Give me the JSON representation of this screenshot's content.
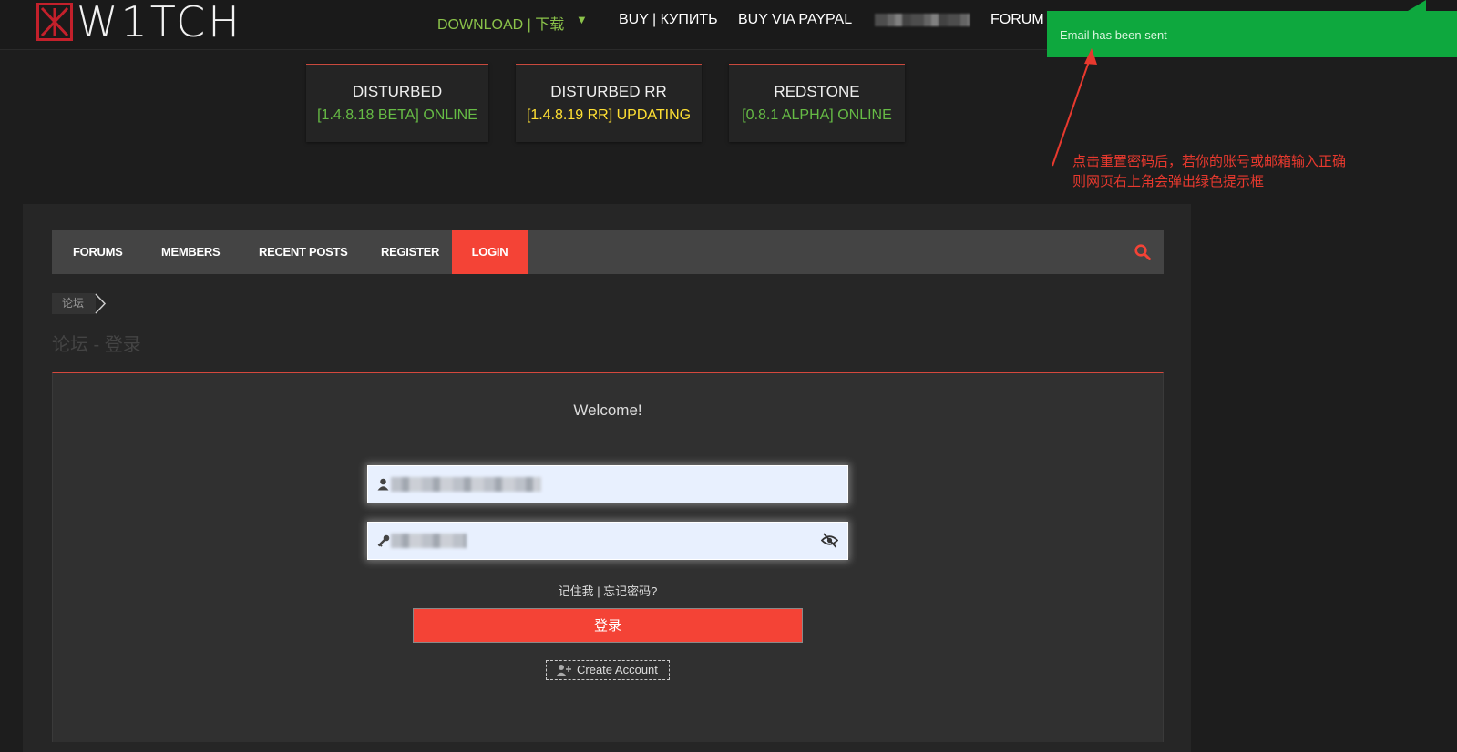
{
  "header": {
    "logo_text": "W1TCH",
    "nav": {
      "download": "DOWNLOAD | 下载",
      "caret": "▼",
      "buy": "BUY | КУПИТЬ",
      "paypal": "BUY VIA PAYPAL",
      "forum": "FORUM |"
    }
  },
  "servers": [
    {
      "name": "DISTURBED",
      "status": "[1.4.8.18 BETA] ONLINE",
      "status_color": "#66bb45"
    },
    {
      "name": "DISTURBED RR",
      "status": "[1.4.8.19 RR] UPDATING",
      "status_color": "#ffe033"
    },
    {
      "name": "REDSTONE",
      "status": "[0.8.1 ALPHA] ONLINE",
      "status_color": "#66bb45"
    }
  ],
  "toast": {
    "text": "Email has been sent",
    "color": "#0ea83e"
  },
  "annotation": {
    "line1": "点击重置密码后，若你的账号或邮箱输入正确",
    "line2": "则网页右上角会弹出绿色提示框",
    "color": "#e8392e"
  },
  "navbar": {
    "items": [
      "FORUMS",
      "MEMBERS",
      "RECENT POSTS",
      "REGISTER",
      "LOGIN"
    ],
    "active": "LOGIN",
    "accent": "#f44336"
  },
  "breadcrumb": {
    "item": "论坛"
  },
  "page_title": "论坛 - 登录",
  "login": {
    "welcome": "Welcome!",
    "links": "记住我 | 忘记密码?",
    "submit": "登录",
    "create_account": "Create Account"
  }
}
